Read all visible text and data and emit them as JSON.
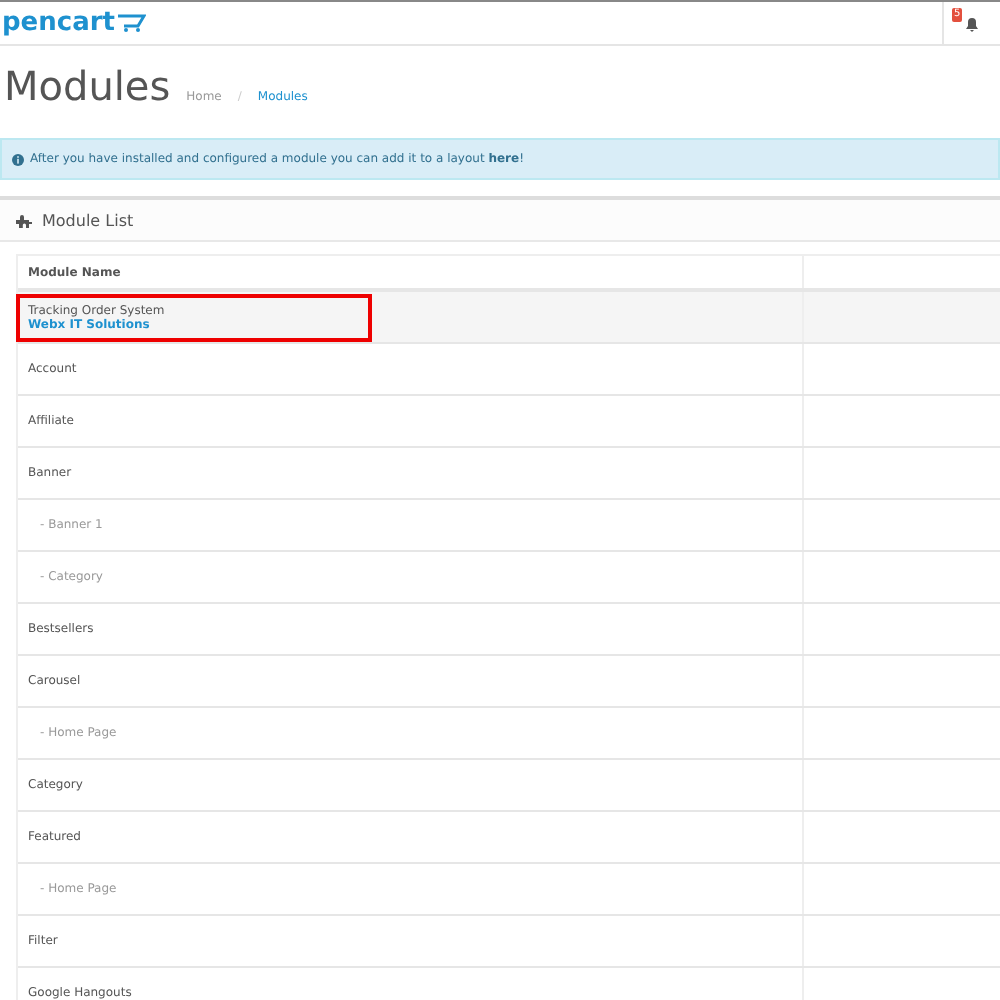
{
  "header": {
    "logo": "pencart",
    "notification_count": "5"
  },
  "page": {
    "title": "Modules",
    "breadcrumbs": [
      "Home",
      "Modules"
    ],
    "breadcrumb_separator": "/"
  },
  "alert": {
    "text": "After you have installed and configured a module you can add it to a layout **here**!"
  },
  "panel": {
    "title": "Module List"
  },
  "table": {
    "columns": [
      "Module Name"
    ],
    "rows": [
      {
        "kind": "vendor",
        "label": "Tracking Order System",
        "vendor": "Webx IT Solutions",
        "highlighted": true
      },
      {
        "kind": "module",
        "label": "Account"
      },
      {
        "kind": "module",
        "label": "Affiliate"
      },
      {
        "kind": "module",
        "label": "Banner"
      },
      {
        "kind": "child",
        "label": "- Banner 1"
      },
      {
        "kind": "child",
        "label": "- Category"
      },
      {
        "kind": "module",
        "label": "Bestsellers"
      },
      {
        "kind": "module",
        "label": "Carousel"
      },
      {
        "kind": "child",
        "label": "- Home Page"
      },
      {
        "kind": "module",
        "label": "Category"
      },
      {
        "kind": "module",
        "label": "Featured"
      },
      {
        "kind": "child",
        "label": "- Home Page"
      },
      {
        "kind": "module",
        "label": "Filter"
      },
      {
        "kind": "module",
        "label": "Google Hangouts"
      }
    ]
  }
}
